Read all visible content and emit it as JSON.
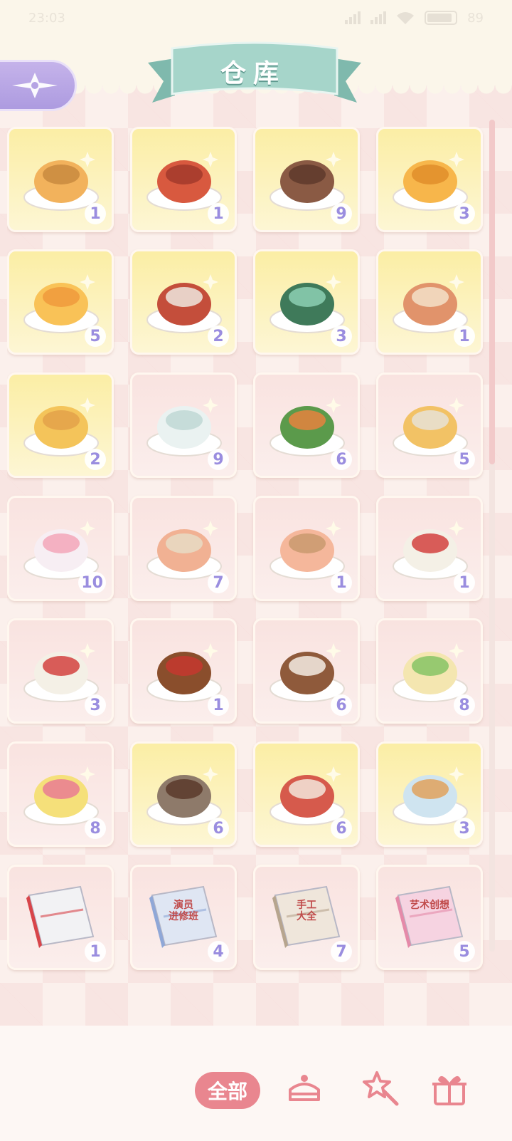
{
  "status_bar": {
    "time": "23:03",
    "battery": "89"
  },
  "header": {
    "title": "仓库"
  },
  "items": [
    {
      "name": "crab-pastry-dish-icon",
      "count": "1",
      "bg": "yellow"
    },
    {
      "name": "noodle-bowl-icon",
      "count": "1",
      "bg": "yellow"
    },
    {
      "name": "chocolate-pudding-icon",
      "count": "9",
      "bg": "yellow"
    },
    {
      "name": "orange-jelly-icon",
      "count": "3",
      "bg": "yellow"
    },
    {
      "name": "orange-drink-icon",
      "count": "5",
      "bg": "yellow"
    },
    {
      "name": "braised-fish-icon",
      "count": "2",
      "bg": "yellow"
    },
    {
      "name": "green-soup-pot-icon",
      "count": "3",
      "bg": "yellow"
    },
    {
      "name": "paw-mooncake-icon",
      "count": "1",
      "bg": "yellow"
    },
    {
      "name": "cat-cake-icon",
      "count": "2",
      "bg": "yellow"
    },
    {
      "name": "yogurt-jar-icon",
      "count": "9",
      "bg": "pink"
    },
    {
      "name": "salad-plate-icon",
      "count": "6",
      "bg": "pink"
    },
    {
      "name": "chicken-soup-icon",
      "count": "5",
      "bg": "pink"
    },
    {
      "name": "bunny-cake-icon",
      "count": "10",
      "bg": "pink"
    },
    {
      "name": "rose-pastry-icon",
      "count": "7",
      "bg": "pink"
    },
    {
      "name": "cream-puff-icon",
      "count": "1",
      "bg": "pink"
    },
    {
      "name": "tangyuan-bowl-icon",
      "count": "1",
      "bg": "pink"
    },
    {
      "name": "tangyuan-bowl-icon",
      "count": "3",
      "bg": "pink"
    },
    {
      "name": "braised-pork-icon",
      "count": "1",
      "bg": "pink"
    },
    {
      "name": "iced-coffee-icon",
      "count": "6",
      "bg": "pink"
    },
    {
      "name": "lime-cake-icon",
      "count": "8",
      "bg": "pink"
    },
    {
      "name": "banana-split-icon",
      "count": "8",
      "bg": "pink"
    },
    {
      "name": "chocolate-box-icon",
      "count": "6",
      "bg": "yellow"
    },
    {
      "name": "fried-chicken-bucket-icon",
      "count": "6",
      "bg": "yellow"
    },
    {
      "name": "snack-ticket-icon",
      "count": "3",
      "bg": "yellow"
    },
    {
      "name": "medical-record-icon",
      "count": "1",
      "bg": "pink"
    },
    {
      "name": "acting-book-icon",
      "count": "4",
      "bg": "pink",
      "label": "演员\n进修班"
    },
    {
      "name": "handicraft-book-icon",
      "count": "7",
      "bg": "pink",
      "label": "手工\n大全"
    },
    {
      "name": "art-book-icon",
      "count": "5",
      "bg": "pink",
      "label": "艺术创想"
    }
  ],
  "tabs": {
    "all_label": "全部"
  },
  "colors": {
    "accent_pink": "#e9868f",
    "count_purple": "#9a8ddf",
    "ribbon_teal": "#9fd0c5",
    "back_purple": "#b6a4e4"
  }
}
